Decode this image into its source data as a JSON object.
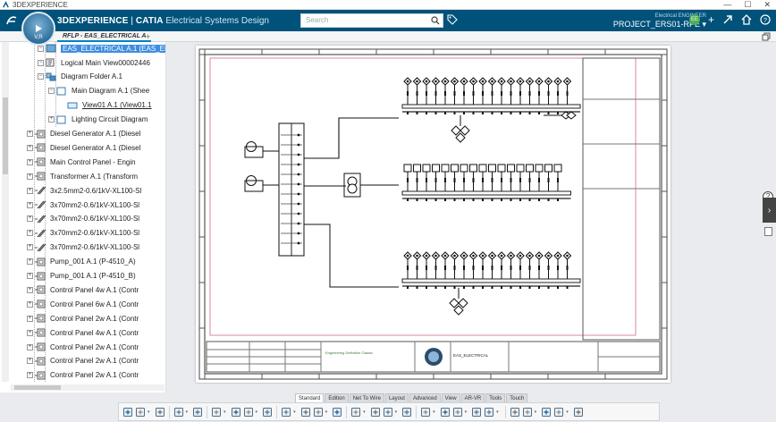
{
  "os_titlebar": {
    "title": "3DEXPERIENCE",
    "controls": [
      "—",
      "☐",
      "✕"
    ]
  },
  "header": {
    "brand_strong": "3DEXPERIENCE",
    "brand_sep": " | ",
    "brand_product": "CATIA",
    "brand_app": " Electrical Systems Design",
    "search_placeholder": "Search",
    "role": "Electrical ENGINEER",
    "project": "PROJECT_ERS01-RPE",
    "avatar_initials": "EE",
    "compass_version": "V,R"
  },
  "tab": {
    "label": "RFLP - EAS_ELECTRICAL A",
    "add": "+"
  },
  "tree": {
    "items": [
      {
        "label": "EAS_ELECTRICAL A.1 (EAS_ELEC",
        "level": 2,
        "icon": "product-icon",
        "selected": true
      },
      {
        "label": "Logical Main View00002446",
        "level": 2,
        "icon": "logical-view-icon"
      },
      {
        "label": "Diagram Folder A.1",
        "level": 2,
        "icon": "folder-icon"
      },
      {
        "label": "Main Diagram A.1 (Shee",
        "level": 3,
        "icon": "diagram-icon"
      },
      {
        "label": "View01 A.1 (View01.1",
        "level": 4,
        "icon": "view-icon",
        "underline": true
      },
      {
        "label": "Lighting Circuit Diagram",
        "level": 3,
        "icon": "diagram-icon"
      },
      {
        "label": "Diesel Generator A.1 (Diesel",
        "level": 1,
        "icon": "equipment-icon"
      },
      {
        "label": "Diesel Generator A.1 (Diesel",
        "level": 1,
        "icon": "equipment-icon"
      },
      {
        "label": "Main Control Panel - Engin",
        "level": 1,
        "icon": "equipment-icon"
      },
      {
        "label": "Transformer A.1 (Transform",
        "level": 1,
        "icon": "equipment-icon"
      },
      {
        "label": "3x2.5mm2-0.6/1kV-XL100-Sl",
        "level": 1,
        "icon": "cable-icon"
      },
      {
        "label": "3x70mm2-0.6/1kV-XL100-Sl",
        "level": 1,
        "icon": "cable-icon"
      },
      {
        "label": "3x70mm2-0.6/1kV-XL100-Sl",
        "level": 1,
        "icon": "cable-icon"
      },
      {
        "label": "3x70mm2-0.6/1kV-XL100-Sl",
        "level": 1,
        "icon": "cable-icon"
      },
      {
        "label": "3x70mm2-0.6/1kV-XL100-Sl",
        "level": 1,
        "icon": "cable-icon"
      },
      {
        "label": "Pump_001 A.1 (P-4510_A)",
        "level": 1,
        "icon": "equipment-icon"
      },
      {
        "label": "Pump_001 A.1 (P-4510_B)",
        "level": 1,
        "icon": "equipment-icon"
      },
      {
        "label": "Control Panel 4w A.1 (Contr",
        "level": 1,
        "icon": "equipment-icon"
      },
      {
        "label": "Control Panel 6w A.1 (Contr",
        "level": 1,
        "icon": "equipment-icon"
      },
      {
        "label": "Control Panel 2w A.1 (Contr",
        "level": 1,
        "icon": "equipment-icon"
      },
      {
        "label": "Control Panel 4w A.1 (Contr",
        "level": 1,
        "icon": "equipment-icon"
      },
      {
        "label": "Control Panel 2w A.1 (Contr",
        "level": 1,
        "icon": "equipment-icon"
      },
      {
        "label": "Control Panel 2w A.1 (Contr",
        "level": 1,
        "icon": "equipment-icon"
      },
      {
        "label": "Control Panel 2w A.1 (Contr",
        "level": 1,
        "icon": "equipment-icon"
      }
    ]
  },
  "drawing": {
    "title_block_company": "EAS_ELECTRICAL",
    "title_block_text": "Engineering Definition Classic"
  },
  "section_tabs": [
    "Standard",
    "Edition",
    "Net To Wire",
    "Layout",
    "Advanced",
    "View",
    "AR-VR",
    "Tools",
    "Touch"
  ],
  "active_section_tab": "Standard",
  "action_bar_icons": [
    "cut-icon",
    "copy-icon",
    "paste-icon",
    "undo-icon",
    "settings-icon",
    "insert-icon",
    "insert-part-icon",
    "view-icon",
    "table-icon",
    "grid-icon",
    "list-icon",
    "frame-icon",
    "cylinder-icon",
    "cabinet-icon",
    "device-icon",
    "compass-icon",
    "route-icon",
    "connector-icon",
    "cable-icon",
    "wire-icon",
    "network-icon",
    "link-icon",
    "bundle-icon",
    "harness-icon",
    "camera-icon",
    "monitor-icon",
    "export-icon"
  ]
}
